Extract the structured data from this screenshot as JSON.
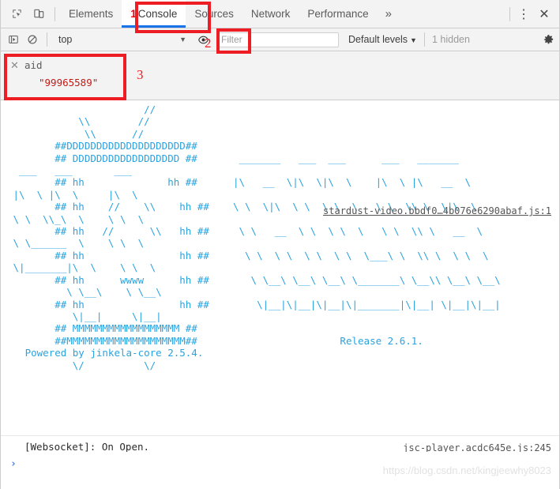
{
  "tabbar": {
    "inspect_icon": "inspect-element-icon",
    "device_icon": "device-toolbar-icon",
    "tabs": [
      {
        "label": "Elements",
        "active": false,
        "prefix_num": ""
      },
      {
        "label": "Console",
        "active": true,
        "prefix_num": "1"
      },
      {
        "label": "Sources",
        "active": false,
        "prefix_num": ""
      },
      {
        "label": "Network",
        "active": false,
        "prefix_num": ""
      },
      {
        "label": "Performance",
        "active": false,
        "prefix_num": ""
      }
    ],
    "more_glyph": "»",
    "kebab_glyph": "⋮",
    "close_glyph": "✕"
  },
  "console_toolbar": {
    "execute_icon": "execute-sidebar-icon",
    "clear_icon": "clear-console-icon",
    "context_value": "top",
    "context_caret": "▼",
    "eye_icon": "create-live-expression-icon",
    "filter_placeholder": "Filter",
    "filter_value": "",
    "levels_label": "Default levels",
    "levels_caret": "▼",
    "hidden_label": "1 hidden",
    "settings_icon": "gear-icon"
  },
  "live_expression": {
    "close_glyph": "✕",
    "name": "aid",
    "value": "\"99965589\""
  },
  "log": {
    "entries": [
      {
        "source": "stardust-video.bbdf0…4b076e6290abaf.js:1",
        "kind": "ascii-art",
        "ascii": "                       //\n            \\\\        //\n             \\\\      //\n        ##DDDDDDDDDDDDDDDDDDDD##\n        ## DDDDDDDDDDDDDDDDDD ##       _______   ___  ___      ___   _______\n  ___   ___       ___\n        ## hh              hh ##      |\\   __  \\|\\  \\|\\  \\    |\\  \\ |\\   __  \\\n |\\  \\ |\\  \\     |\\  \\\n        ## hh    //    \\\\    hh ##    \\ \\  \\|\\  \\ \\  \\ \\  \\   \\ \\  \\\\ \\  \\|\\  \\\n \\ \\  \\\\_\\  \\    \\ \\  \\\n        ## hh   //      \\\\   hh ##     \\ \\   __  \\ \\  \\ \\  \\   \\ \\  \\\\ \\   __  \\\n \\ \\______  \\    \\ \\  \\\n        ## hh                hh ##      \\ \\  \\ \\  \\ \\  \\ \\  \\___\\ \\  \\\\ \\  \\ \\  \\\n \\|_______|\\  \\    \\ \\  \\\n        ## hh      wwww      hh ##       \\ \\__\\ \\__\\ \\__\\ \\_______\\ \\__\\\\ \\__\\ \\__\\\n          \\ \\__\\    \\ \\__\\\n        ## hh                hh ##        \\|__|\\|__|\\|__|\\|_______|\\|__| \\|__|\\|__|\n           \\|__|     \\|__|\n        ## MMMMMMMMMMMMMMMMMM ##\n        ##MMMMMMMMMMMMMMMMMMMM##                        Release 2.6.1.\n   Powered by jinkela-core 2.5.4.\n           \\/          \\/",
        "release": "Release 2.6.1.",
        "powered_by": "Powered by jinkela-core 2.5.4."
      },
      {
        "source": "jsc-player.acdc645e.js:245",
        "kind": "text",
        "text": "[Websocket]: On Open."
      }
    ]
  },
  "prompt": {
    "caret": "›",
    "value": ""
  },
  "annotations": [
    {
      "id": "1",
      "target": "console-tab"
    },
    {
      "id": "2",
      "target": "live-expression-eye-button"
    },
    {
      "id": "3",
      "target": "live-expression-pinned-row"
    }
  ],
  "watermark": "https://blog.csdn.net/kingjeewhy8023",
  "colors": {
    "ascii": "#29a3df",
    "annotation_red": "#ee1c23",
    "string_value": "#c41a16",
    "active_tab_underline": "#1a73e8",
    "toolbar_bg": "#f3f3f3"
  }
}
